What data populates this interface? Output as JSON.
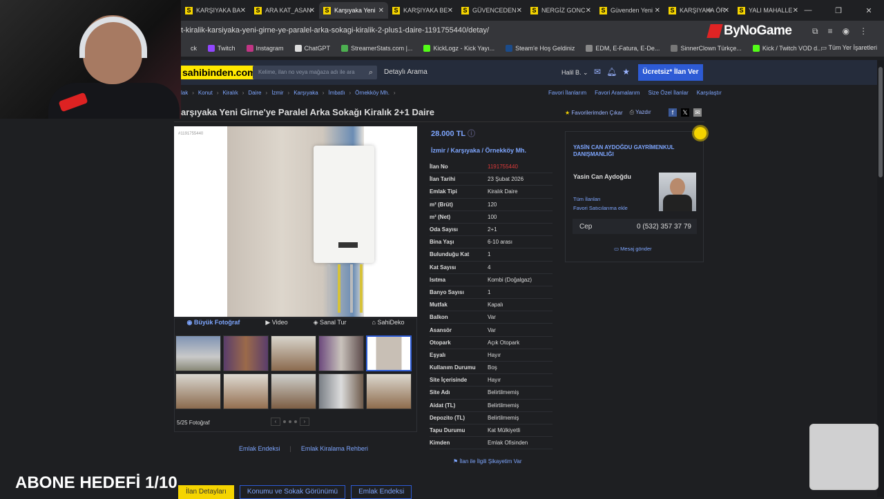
{
  "browser": {
    "tabs": [
      {
        "label": "KARŞIYAKA BA"
      },
      {
        "label": "ARA KAT_ASAN"
      },
      {
        "label": "Karşıyaka Yeni",
        "active": true
      },
      {
        "label": "KARŞIYAKA BE"
      },
      {
        "label": "GÜVENCEDEN"
      },
      {
        "label": "NERGİZ GONC"
      },
      {
        "label": "Güvenden Yeni"
      },
      {
        "label": "KARŞIYAKA ÖR"
      },
      {
        "label": "YALI MAHALLE"
      }
    ],
    "url": "t-kiralik-karsiyaka-yeni-girne-ye-paralel-arka-sokagi-kiralik-2-plus1-daire-1191755440/detay/",
    "bookmarks": [
      "ck",
      "Twitch",
      "Instagram",
      "ChatGPT",
      "StreamerStats.com |...",
      "KickLogz - Kick Yayı...",
      "Steam'e Hoş Geldiniz",
      "EDM, E-Fatura, E-De...",
      "SinnerClown Türkçe...",
      "Kick / Twitch VOD d..."
    ],
    "all_bookmarks": "Tüm Yer İşaretleri",
    "overlay_logo": "ByNoGame"
  },
  "site": {
    "logo": "sahibinden.com",
    "search_placeholder": "Kelime, ilan no veya mağaza adı ile ara",
    "detailed_search": "Detaylı Arama",
    "user": "Halil B.",
    "post_button": "Ücretsiz* İlan Ver"
  },
  "breadcrumb": [
    "lak",
    "Konut",
    "Kiralık",
    "Daire",
    "İzmir",
    "Karşıyaka",
    "İmbatlı",
    "Örnekköy Mh."
  ],
  "right_links": [
    "Favori İlanlarım",
    "Favori Aramalarım",
    "Size Özel İlanlar",
    "Karşılaştır"
  ],
  "listing": {
    "title": "arşıyaka Yeni Girne'ye Paralel Arka Sokağı Kiralık 2+1 Daire",
    "fav_remove": "Favorilerimden Çıkar",
    "print": "Yazdır",
    "photo_id": "#1191755440",
    "price": "28.000 TL",
    "location": "İzmir / Karşıyaka / Örnekköy Mh.",
    "photo_tabs": [
      "Büyük Fotoğraf",
      "Video",
      "Sanal Tur",
      "SahiDeko"
    ],
    "photo_count": "5/25 Fotoğraf",
    "details": [
      {
        "k": "İlan No",
        "v": "1191755440",
        "red": true
      },
      {
        "k": "İlan Tarihi",
        "v": "23 Şubat 2026"
      },
      {
        "k": "Emlak Tipi",
        "v": "Kiralık Daire"
      },
      {
        "k": "m² (Brüt)",
        "v": "120"
      },
      {
        "k": "m² (Net)",
        "v": "100"
      },
      {
        "k": "Oda Sayısı",
        "v": "2+1"
      },
      {
        "k": "Bina Yaşı",
        "v": "6-10 arası"
      },
      {
        "k": "Bulunduğu Kat",
        "v": "1"
      },
      {
        "k": "Kat Sayısı",
        "v": "4"
      },
      {
        "k": "Isıtma",
        "v": "Kombi (Doğalgaz)"
      },
      {
        "k": "Banyo Sayısı",
        "v": "1"
      },
      {
        "k": "Mutfak",
        "v": "Kapalı"
      },
      {
        "k": "Balkon",
        "v": "Var"
      },
      {
        "k": "Asansör",
        "v": "Var"
      },
      {
        "k": "Otopark",
        "v": "Açık Otopark"
      },
      {
        "k": "Eşyalı",
        "v": "Hayır"
      },
      {
        "k": "Kullanım Durumu",
        "v": "Boş"
      },
      {
        "k": "Site İçerisinde",
        "v": "Hayır"
      },
      {
        "k": "Site Adı",
        "v": "Belirtilmemiş"
      },
      {
        "k": "Aidat (TL)",
        "v": "Belirtilmemiş"
      },
      {
        "k": "Depozito (TL)",
        "v": "Belirtilmemiş"
      },
      {
        "k": "Tapu Durumu",
        "v": "Kat Mülkiyetli"
      },
      {
        "k": "Kimden",
        "v": "Emlak Ofisinden"
      }
    ],
    "complaint": "İlan ile İlgili Şikayetim Var"
  },
  "agent": {
    "company": "YASİN CAN AYDOĞDU GAYRİMENKUL DANIŞMANLIĞI",
    "name": "Yasin Can Aydoğdu",
    "all_listings": "Tüm İlanları",
    "add_fav": "Favori Satıcılarıma ekle",
    "phone_label": "Cep",
    "phone": "0 (532) 357 37 79",
    "message": "Mesaj gönder"
  },
  "footer_links": [
    "Emlak Endeksi",
    "Emlak Kiralama Rehberi"
  ],
  "bottom_tabs": [
    "İlan Detayları",
    "Konumu ve Sokak Görünümü",
    "Emlak Endeksi"
  ],
  "overlay_text": "ABONE HEDEFİ 1/10"
}
